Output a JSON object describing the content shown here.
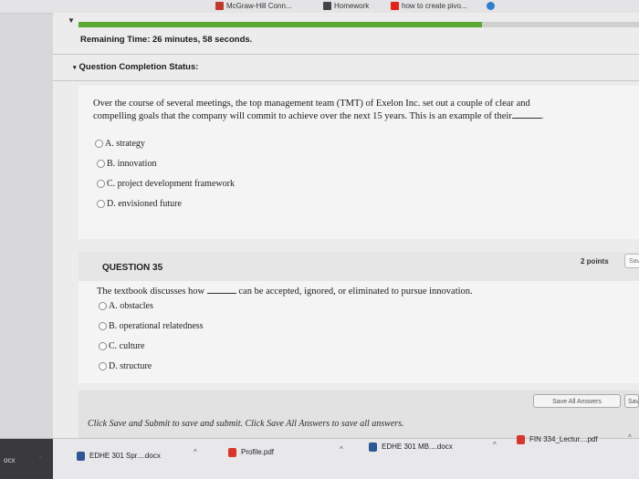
{
  "bookmarks": [
    {
      "label": "McGraw-Hill Conn...",
      "icon": "mcgraw-hill-icon"
    },
    {
      "label": "Homework",
      "icon": "document-icon"
    },
    {
      "label": "how to create pivo...",
      "icon": "youtube-icon"
    }
  ],
  "assessment": {
    "remaining_time": "Remaining Time: 26 minutes, 58 seconds.",
    "completion_status_label": "Question Completion Status:",
    "progress_fraction": 0.72
  },
  "question34": {
    "text_before_blank": "Over the course of several meetings, the top management team (TMT) of Exelon Inc. set out a couple of clear and compelling goals that the company will commit to achieve over the next 15 years. This is an example of their",
    "text_after_blank": ".",
    "options": [
      {
        "label": "A. strategy"
      },
      {
        "label": "B. innovation"
      },
      {
        "label": "C. project development framework"
      },
      {
        "label": "D. envisioned future"
      }
    ]
  },
  "question35": {
    "title": "QUESTION 35",
    "points": "2 points",
    "save_label": "Save",
    "text_before_blank": "The textbook discusses how",
    "text_after_blank": "can be accepted, ignored, or eliminated to pursue innovation.",
    "options": [
      {
        "label": "A. obstacles"
      },
      {
        "label": "B. operational relatedness"
      },
      {
        "label": "C. culture"
      },
      {
        "label": "D. structure"
      }
    ]
  },
  "footer": {
    "instructions": "Click Save and Submit to save and submit. Click Save All Answers to save all answers.",
    "save_all_label": "Save All Answers",
    "save_submit_label": "Save and"
  },
  "downloads": [
    {
      "label": "ocx",
      "icon": "word-doc-icon"
    },
    {
      "label": "EDHE 301 Spr....docx",
      "icon": "word-doc-icon"
    },
    {
      "label": "Profile.pdf",
      "icon": "pdf-icon"
    },
    {
      "label": "EDHE 301 MB....docx",
      "icon": "word-doc-icon"
    },
    {
      "label": "FIN 334_Lectur....pdf",
      "icon": "pdf-icon"
    }
  ],
  "colors": {
    "progress": "#5aa832",
    "pdf_icon": "#d9352a",
    "doc_icon": "#2b5797",
    "youtube": "#e62117"
  }
}
